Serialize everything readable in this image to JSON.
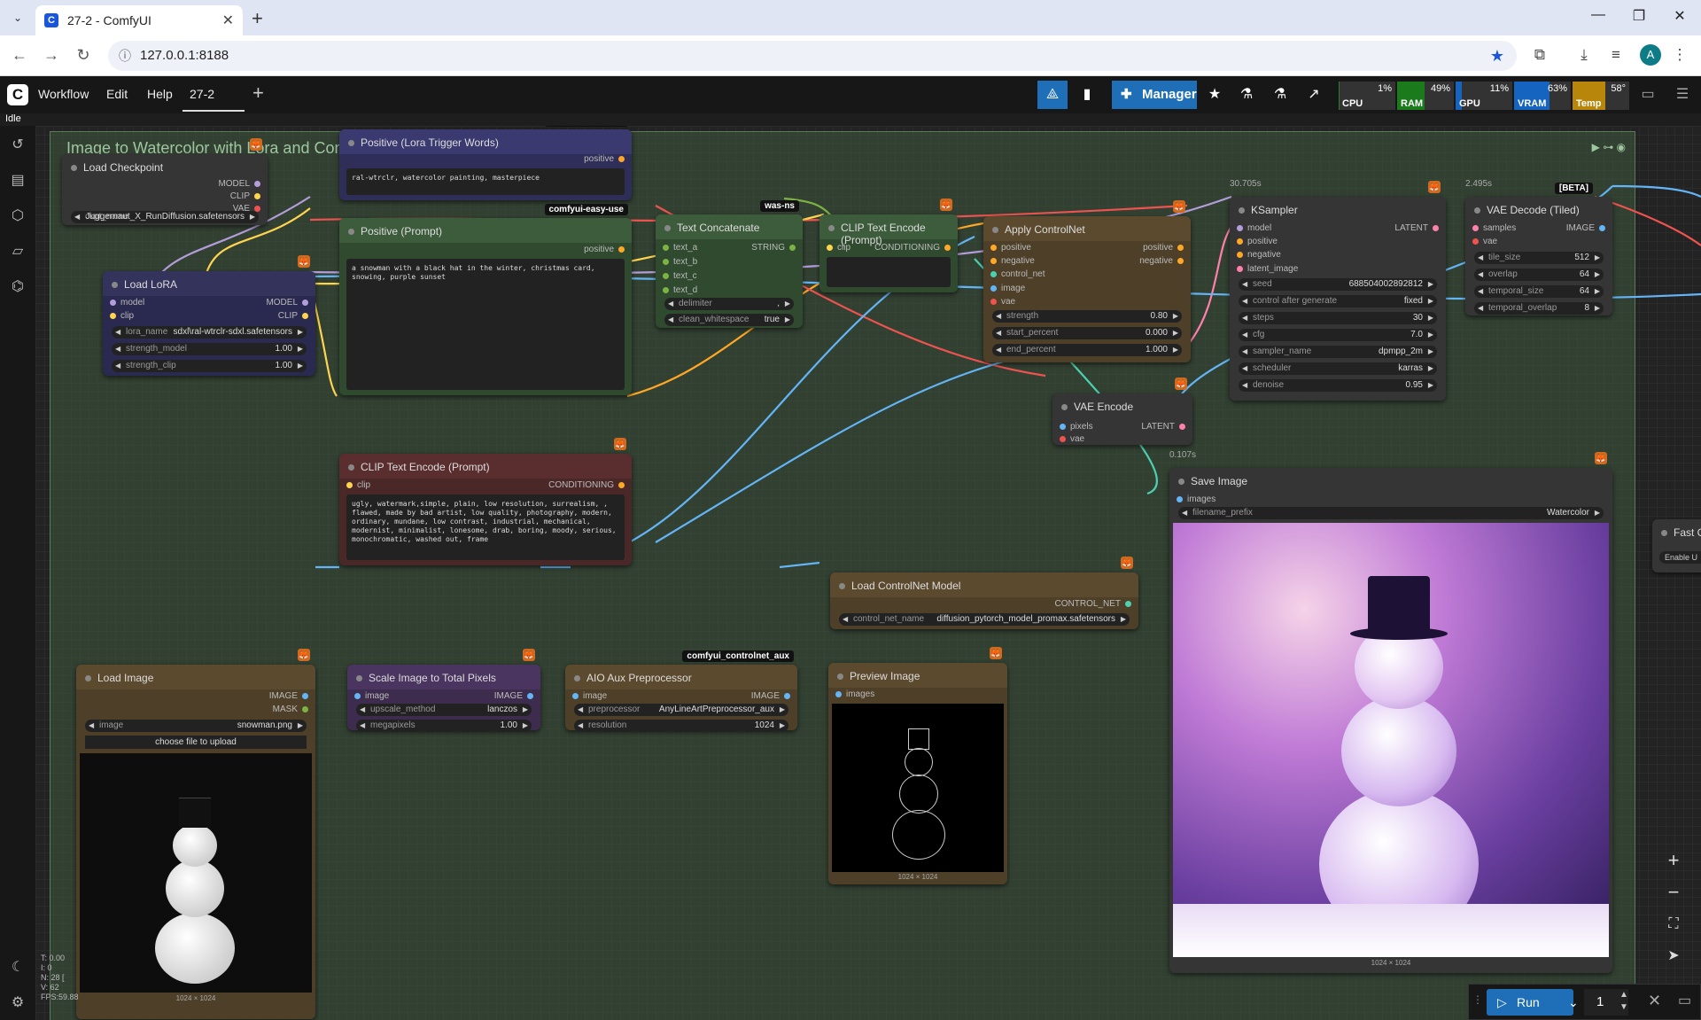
{
  "browser": {
    "tab_title": "27-2 - ComfyUI",
    "url": "127.0.0.1:8188",
    "profile_initial": "A"
  },
  "menubar": {
    "items": [
      "Workflow",
      "Edit",
      "Help"
    ],
    "workflow_tab": "27-2",
    "manager_label": "Manager"
  },
  "monitors": [
    {
      "label": "CPU",
      "value": "1%",
      "color": "#2e7d32",
      "fill": 0.01
    },
    {
      "label": "RAM",
      "value": "49%",
      "color": "#1b7a1b",
      "fill": 0.49
    },
    {
      "label": "GPU",
      "value": "11%",
      "color": "#1565c0",
      "fill": 0.11
    },
    {
      "label": "VRAM",
      "value": "63%",
      "color": "#1565c0",
      "fill": 0.63
    },
    {
      "label": "Temp",
      "value": "58°",
      "color": "#b8860b",
      "fill": 0.58
    }
  ],
  "status": "Idle",
  "group_title": "Image to Watercolor with Lora and Control Net - Pixaroma",
  "nodes": {
    "load_checkpoint": {
      "title": "Load Checkpoint",
      "outputs": [
        "MODEL",
        "CLIP",
        "VAE"
      ],
      "ckpt_label": "ckpt_name",
      "ckpt_value": "Juggernaut_X_RunDiffusion.safetensors"
    },
    "positive_lora": {
      "title": "Positive (Lora Trigger Words)",
      "badge": "comfyui-easy-use",
      "output": "positive",
      "text": "ral-wtrclr, watercolor painting, masterpiece"
    },
    "positive_prompt": {
      "title": "Positive (Prompt)",
      "badge": "comfyui-easy-use",
      "output": "positive",
      "text": "a snowman with a black hat in the winter, christmas card, snowing, purple sunset"
    },
    "load_lora": {
      "title": "Load LoRA",
      "inputs": [
        "model",
        "clip"
      ],
      "outputs": [
        "MODEL",
        "CLIP"
      ],
      "widgets": [
        {
          "label": "lora_name",
          "value": "sdxl\\ral-wtrclr-sdxl.safetensors"
        },
        {
          "label": "strength_model",
          "value": "1.00"
        },
        {
          "label": "strength_clip",
          "value": "1.00"
        }
      ]
    },
    "text_concat": {
      "title": "Text Concatenate",
      "badge": "was-ns",
      "inputs": [
        "text_a",
        "text_b",
        "text_c",
        "text_d"
      ],
      "output": "STRING",
      "widgets": [
        {
          "label": "delimiter",
          "value": ","
        },
        {
          "label": "clean_whitespace",
          "value": "true"
        }
      ]
    },
    "clip_encode_pos": {
      "title": "CLIP Text Encode (Prompt)",
      "input": "clip",
      "output": "CONDITIONING"
    },
    "apply_controlnet": {
      "title": "Apply ControlNet",
      "inputs": [
        "positive",
        "negative",
        "control_net",
        "image",
        "vae"
      ],
      "outputs": [
        "positive",
        "negative"
      ],
      "widgets": [
        {
          "label": "strength",
          "value": "0.80"
        },
        {
          "label": "start_percent",
          "value": "0.000"
        },
        {
          "label": "end_percent",
          "value": "1.000"
        }
      ]
    },
    "ksampler": {
      "title": "KSampler",
      "timing": "30.705s",
      "inputs": [
        "model",
        "positive",
        "negative",
        "latent_image"
      ],
      "output": "LATENT",
      "widgets": [
        {
          "label": "seed",
          "value": "688504002892812"
        },
        {
          "label": "control after generate",
          "value": "fixed"
        },
        {
          "label": "steps",
          "value": "30"
        },
        {
          "label": "cfg",
          "value": "7.0"
        },
        {
          "label": "sampler_name",
          "value": "dpmpp_2m"
        },
        {
          "label": "scheduler",
          "value": "karras"
        },
        {
          "label": "denoise",
          "value": "0.95"
        }
      ]
    },
    "vae_decode": {
      "title": "VAE Decode (Tiled)",
      "timing": "2.495s",
      "badge": "[BETA]",
      "inputs": [
        "samples",
        "vae"
      ],
      "output": "IMAGE",
      "widgets": [
        {
          "label": "tile_size",
          "value": "512"
        },
        {
          "label": "overlap",
          "value": "64"
        },
        {
          "label": "temporal_size",
          "value": "64"
        },
        {
          "label": "temporal_overlap",
          "value": "8"
        }
      ]
    },
    "vae_encode": {
      "title": "VAE Encode",
      "inputs": [
        "pixels",
        "vae"
      ],
      "output": "LATENT"
    },
    "clip_encode_neg": {
      "title": "CLIP Text Encode (Prompt)",
      "input": "clip",
      "output": "CONDITIONING",
      "text": "ugly, watermark,simple, plain, low resolution, surrealism, , flawed, made by bad artist, low quality, photography, modern, ordinary, mundane, low contrast, industrial, mechanical, modernist, minimalist, lonesome, drab, boring, moody, serious, monochromatic, washed out, frame"
    },
    "save_image": {
      "title": "Save Image",
      "timing": "0.107s",
      "input": "images",
      "widget": {
        "label": "filename_prefix",
        "value": "Watercolor"
      },
      "dims": "1024 × 1024"
    },
    "load_controlnet": {
      "title": "Load ControlNet Model",
      "output": "CONTROL_NET",
      "widget": {
        "label": "control_net_name",
        "value": "diffusion_pytorch_model_promax.safetensors"
      }
    },
    "load_image": {
      "title": "Load Image",
      "outputs": [
        "IMAGE",
        "MASK"
      ],
      "widget": {
        "label": "image",
        "value": "snowman.png"
      },
      "upload_label": "choose file to upload",
      "dims": "1024 × 1024"
    },
    "scale_image": {
      "title": "Scale Image to Total Pixels",
      "input": "image",
      "output": "IMAGE",
      "widgets": [
        {
          "label": "upscale_method",
          "value": "lanczos"
        },
        {
          "label": "megapixels",
          "value": "1.00"
        }
      ]
    },
    "aio_aux": {
      "title": "AIO Aux Preprocessor",
      "badge": "comfyui_controlnet_aux",
      "input": "image",
      "output": "IMAGE",
      "widgets": [
        {
          "label": "preprocessor",
          "value": "AnyLineArtPreprocessor_aux"
        },
        {
          "label": "resolution",
          "value": "1024"
        }
      ]
    },
    "preview_image": {
      "title": "Preview Image",
      "input": "images",
      "dims": "1024 × 1024"
    },
    "fast_groups": {
      "title": "Fast G",
      "button": "Enable U"
    }
  },
  "run_bar": {
    "run_label": "Run",
    "queue_count": "1"
  },
  "stats": [
    "T: 0.00",
    "I: 0",
    "N: 28 [",
    "V: 62",
    "FPS:59.88"
  ]
}
